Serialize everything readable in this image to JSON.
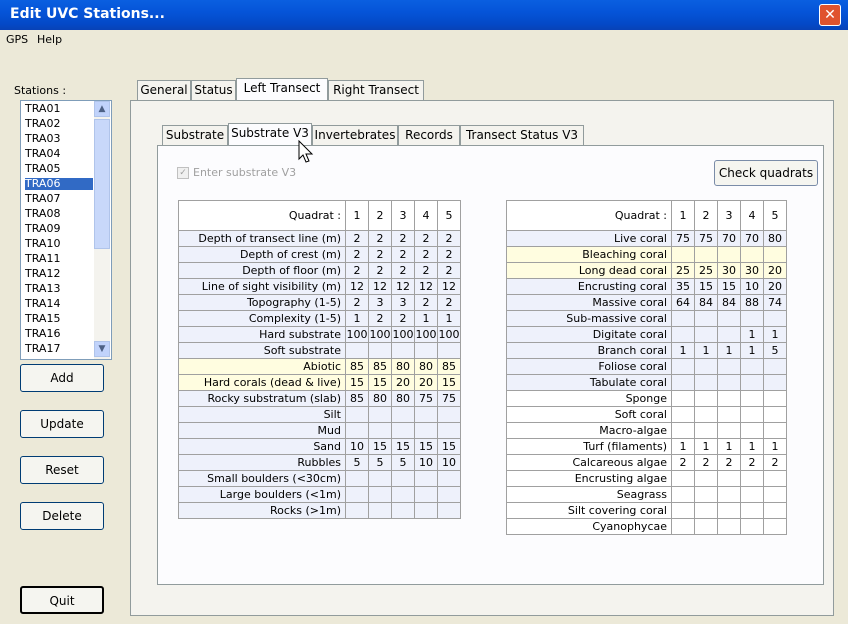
{
  "window": {
    "title": "Edit UVC Stations...",
    "close_glyph": "✕"
  },
  "menu": [
    "GPS",
    "Help"
  ],
  "stations": {
    "label": "Stations :",
    "items": [
      "TRA01",
      "TRA02",
      "TRA03",
      "TRA04",
      "TRA05",
      "TRA06",
      "TRA07",
      "TRA08",
      "TRA09",
      "TRA10",
      "TRA11",
      "TRA12",
      "TRA13",
      "TRA14",
      "TRA15",
      "TRA16",
      "TRA17"
    ],
    "selected": "TRA06"
  },
  "buttons": {
    "add": "Add",
    "update": "Update",
    "reset": "Reset",
    "delete": "Delete",
    "quit": "Quit",
    "check_quadrats": "Check quadrats"
  },
  "tabs_main": [
    "General",
    "Status",
    "Left Transect",
    "Right Transect"
  ],
  "tabs_sub": [
    "Substrate",
    "Substrate V3",
    "Invertebrates",
    "Records",
    "Transect Status V3"
  ],
  "enter_substrate_label": "Enter substrate V3",
  "left_table": {
    "header": "Quadrat :",
    "quadrats": [
      "1",
      "2",
      "3",
      "4",
      "5"
    ],
    "rows": [
      {
        "label": "Depth of transect line (m)",
        "values": [
          "2",
          "2",
          "2",
          "2",
          "2"
        ],
        "style": "lt"
      },
      {
        "label": "Depth of crest (m)",
        "values": [
          "2",
          "2",
          "2",
          "2",
          "2"
        ],
        "style": "lt"
      },
      {
        "label": "Depth of floor (m)",
        "values": [
          "2",
          "2",
          "2",
          "2",
          "2"
        ],
        "style": "lt"
      },
      {
        "label": "Line of sight visibility (m)",
        "values": [
          "12",
          "12",
          "12",
          "12",
          "12"
        ],
        "style": "lt"
      },
      {
        "label": "Topography (1-5)",
        "values": [
          "2",
          "3",
          "3",
          "2",
          "2"
        ],
        "style": "lt"
      },
      {
        "label": "Complexity (1-5)",
        "values": [
          "1",
          "2",
          "2",
          "1",
          "1"
        ],
        "style": "lt"
      },
      {
        "label": "Hard substrate",
        "values": [
          "100",
          "100",
          "100",
          "100",
          "100"
        ],
        "style": "lt"
      },
      {
        "label": "Soft substrate",
        "values": [
          "",
          "",
          "",
          "",
          ""
        ],
        "style": "lt"
      },
      {
        "label": "Abiotic",
        "values": [
          "85",
          "85",
          "80",
          "80",
          "85"
        ],
        "style": "yl"
      },
      {
        "label": "Hard corals (dead & live)",
        "values": [
          "15",
          "15",
          "20",
          "20",
          "15"
        ],
        "style": "yl"
      },
      {
        "label": "Rocky substratum (slab)",
        "values": [
          "85",
          "80",
          "80",
          "75",
          "75"
        ],
        "style": "lt"
      },
      {
        "label": "Silt",
        "values": [
          "",
          "",
          "",
          "",
          ""
        ],
        "style": "lt"
      },
      {
        "label": "Mud",
        "values": [
          "",
          "",
          "",
          "",
          ""
        ],
        "style": "lt"
      },
      {
        "label": "Sand",
        "values": [
          "10",
          "15",
          "15",
          "15",
          "15"
        ],
        "style": "lt"
      },
      {
        "label": "Rubbles",
        "values": [
          "5",
          "5",
          "5",
          "10",
          "10"
        ],
        "style": "lt"
      },
      {
        "label": "Small boulders (<30cm)",
        "values": [
          "",
          "",
          "",
          "",
          ""
        ],
        "style": "lt"
      },
      {
        "label": "Large boulders (<1m)",
        "values": [
          "",
          "",
          "",
          "",
          ""
        ],
        "style": "lt"
      },
      {
        "label": "Rocks (>1m)",
        "values": [
          "",
          "",
          "",
          "",
          ""
        ],
        "style": "lt"
      }
    ]
  },
  "right_table": {
    "header": "Quadrat :",
    "quadrats": [
      "1",
      "2",
      "3",
      "4",
      "5"
    ],
    "rows": [
      {
        "label": "Live coral",
        "values": [
          "75",
          "75",
          "70",
          "70",
          "80"
        ],
        "style": "lt"
      },
      {
        "label": "Bleaching coral",
        "values": [
          "",
          "",
          "",
          "",
          ""
        ],
        "style": "yl"
      },
      {
        "label": "Long dead coral",
        "values": [
          "25",
          "25",
          "30",
          "30",
          "20"
        ],
        "style": "yl"
      },
      {
        "label": "Encrusting coral",
        "values": [
          "35",
          "15",
          "15",
          "10",
          "20"
        ],
        "style": "lt"
      },
      {
        "label": "Massive coral",
        "values": [
          "64",
          "84",
          "84",
          "88",
          "74"
        ],
        "style": "lt"
      },
      {
        "label": "Sub-massive coral",
        "values": [
          "",
          "",
          "",
          "",
          ""
        ],
        "style": "lt"
      },
      {
        "label": "Digitate coral",
        "values": [
          "",
          "",
          "",
          "1",
          "1"
        ],
        "style": "lt"
      },
      {
        "label": "Branch coral",
        "values": [
          "1",
          "1",
          "1",
          "1",
          "5"
        ],
        "style": "lt"
      },
      {
        "label": "Foliose coral",
        "values": [
          "",
          "",
          "",
          "",
          ""
        ],
        "style": "lt"
      },
      {
        "label": "Tabulate coral",
        "values": [
          "",
          "",
          "",
          "",
          ""
        ],
        "style": "lt"
      },
      {
        "label": "Sponge",
        "values": [
          "",
          "",
          "",
          "",
          ""
        ],
        "style": "wt"
      },
      {
        "label": "Soft coral",
        "values": [
          "",
          "",
          "",
          "",
          ""
        ],
        "style": "wt"
      },
      {
        "label": "Macro-algae",
        "values": [
          "",
          "",
          "",
          "",
          ""
        ],
        "style": "wt"
      },
      {
        "label": "Turf (filaments)",
        "values": [
          "1",
          "1",
          "1",
          "1",
          "1"
        ],
        "style": "wt"
      },
      {
        "label": "Calcareous algae",
        "values": [
          "2",
          "2",
          "2",
          "2",
          "2"
        ],
        "style": "wt"
      },
      {
        "label": "Encrusting algae",
        "values": [
          "",
          "",
          "",
          "",
          ""
        ],
        "style": "wt"
      },
      {
        "label": "Seagrass",
        "values": [
          "",
          "",
          "",
          "",
          ""
        ],
        "style": "wt"
      },
      {
        "label": "Silt covering coral",
        "values": [
          "",
          "",
          "",
          "",
          ""
        ],
        "style": "wt"
      },
      {
        "label": "Cyanophycae",
        "values": [
          "",
          "",
          "",
          "",
          ""
        ],
        "style": "wt"
      }
    ]
  }
}
